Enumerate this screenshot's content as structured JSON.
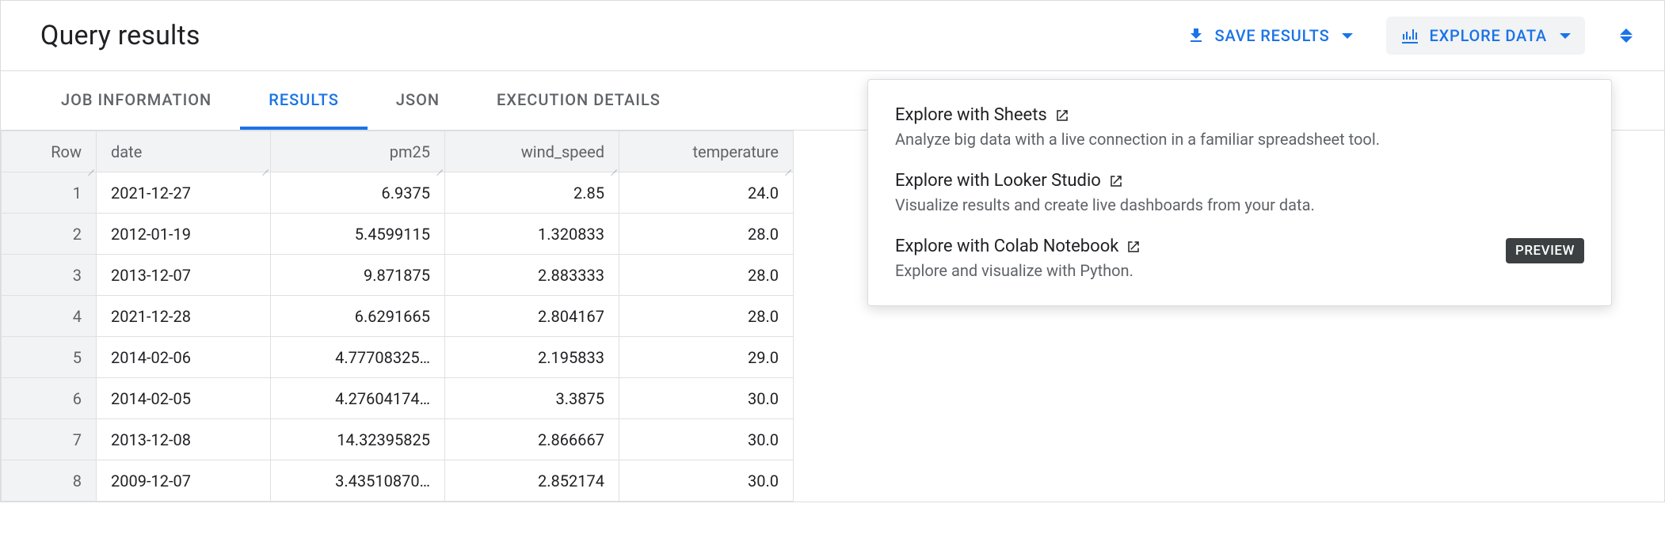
{
  "header": {
    "title": "Query results",
    "save_results_label": "SAVE RESULTS",
    "explore_data_label": "EXPLORE DATA"
  },
  "tabs": [
    {
      "label": "JOB INFORMATION",
      "active": false
    },
    {
      "label": "RESULTS",
      "active": true
    },
    {
      "label": "JSON",
      "active": false
    },
    {
      "label": "EXECUTION DETAILS",
      "active": false
    }
  ],
  "table": {
    "columns": [
      "Row",
      "date",
      "pm25",
      "wind_speed",
      "temperature"
    ],
    "rows": [
      {
        "row": "1",
        "date": "2021-12-27",
        "pm25": "6.9375",
        "wind_speed": "2.85",
        "temperature": "24.0"
      },
      {
        "row": "2",
        "date": "2012-01-19",
        "pm25": "5.4599115",
        "wind_speed": "1.320833",
        "temperature": "28.0"
      },
      {
        "row": "3",
        "date": "2013-12-07",
        "pm25": "9.871875",
        "wind_speed": "2.883333",
        "temperature": "28.0"
      },
      {
        "row": "4",
        "date": "2021-12-28",
        "pm25": "6.6291665",
        "wind_speed": "2.804167",
        "temperature": "28.0"
      },
      {
        "row": "5",
        "date": "2014-02-06",
        "pm25": "4.77708325…",
        "wind_speed": "2.195833",
        "temperature": "29.0"
      },
      {
        "row": "6",
        "date": "2014-02-05",
        "pm25": "4.27604174…",
        "wind_speed": "3.3875",
        "temperature": "30.0"
      },
      {
        "row": "7",
        "date": "2013-12-08",
        "pm25": "14.32395825",
        "wind_speed": "2.866667",
        "temperature": "30.0"
      },
      {
        "row": "8",
        "date": "2009-12-07",
        "pm25": "3.43510870…",
        "wind_speed": "2.852174",
        "temperature": "30.0"
      }
    ]
  },
  "dropdown": {
    "items": [
      {
        "title": "Explore with Sheets",
        "desc": "Analyze big data with a live connection in a familiar spreadsheet tool.",
        "badge": null
      },
      {
        "title": "Explore with Looker Studio",
        "desc": "Visualize results and create live dashboards from your data.",
        "badge": null
      },
      {
        "title": "Explore with Colab Notebook",
        "desc": "Explore and visualize with Python.",
        "badge": "PREVIEW"
      }
    ]
  }
}
